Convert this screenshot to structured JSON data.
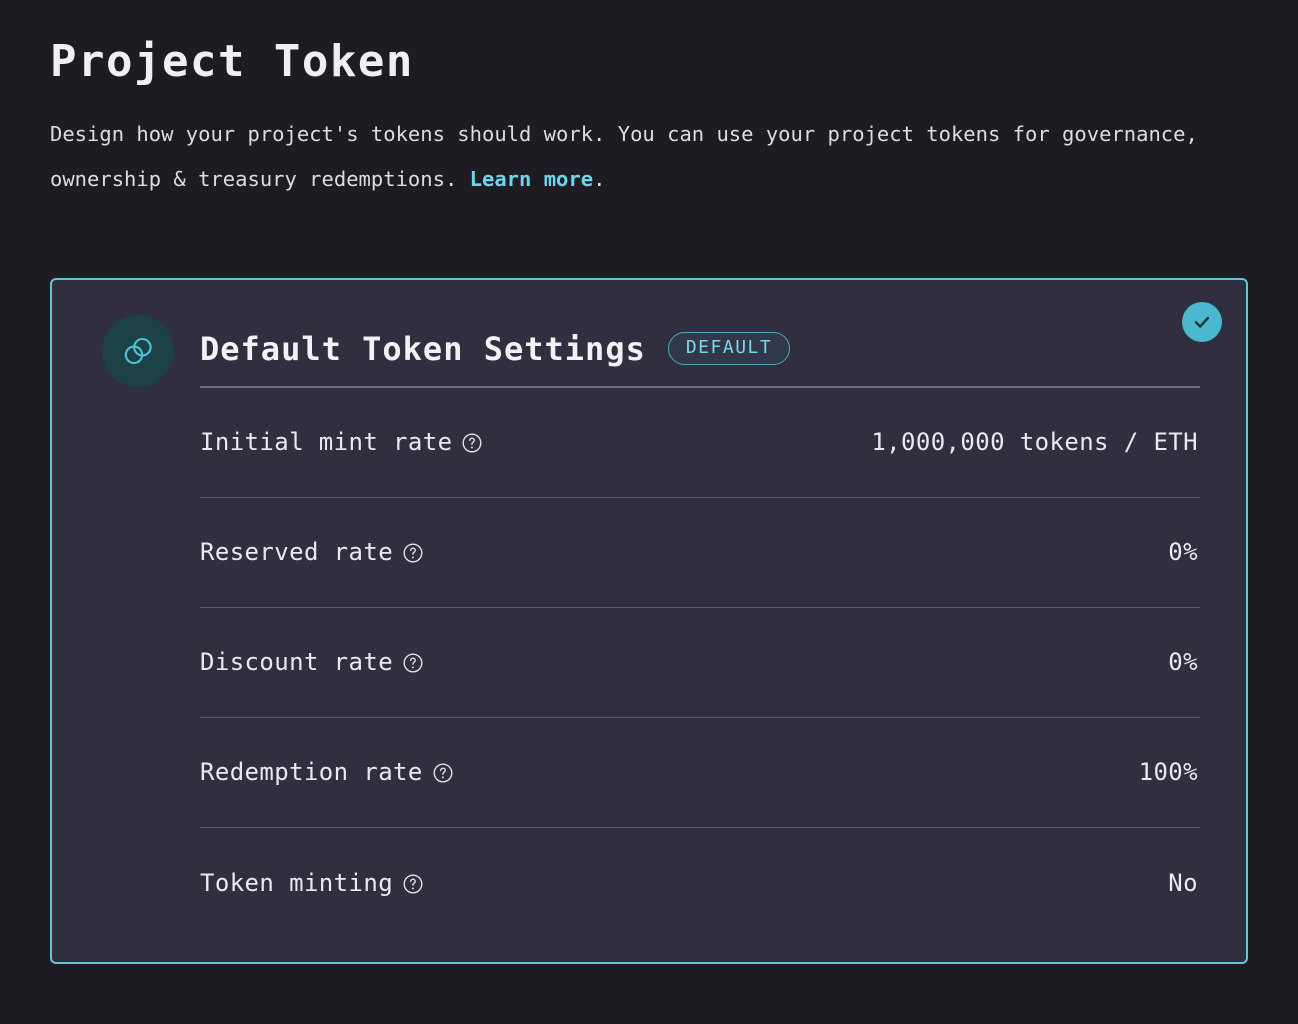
{
  "header": {
    "title": "Project Token",
    "description_part1": "Design how your project's tokens should work. You can use your project tokens for governance, ownership & treasury redemptions. ",
    "learn_more_label": "Learn more",
    "description_part2": "."
  },
  "card": {
    "icon_name": "overlapping-circles-token-icon",
    "title": "Default Token Settings",
    "badge_label": "DEFAULT",
    "selected": true,
    "check_icon_name": "check-circle-icon",
    "rows": [
      {
        "label": "Initial mint rate",
        "help": "?",
        "value": "1,000,000 tokens / ETH"
      },
      {
        "label": "Reserved rate",
        "help": "?",
        "value": "0%"
      },
      {
        "label": "Discount rate",
        "help": "?",
        "value": "0%"
      },
      {
        "label": "Redemption rate",
        "help": "?",
        "value": "100%"
      },
      {
        "label": "Token minting",
        "help": "?",
        "value": "No"
      }
    ]
  },
  "colors": {
    "page_background": "#1e1c22",
    "card_background": "#302e3f",
    "accent_teal": "#65c4d8",
    "link_teal": "#6fd5e8",
    "badge_teal": "#7fd5e6",
    "check_badge": "#4ab8cf",
    "divider": "#5e5d70",
    "text_primary": "#f0f0f3"
  }
}
